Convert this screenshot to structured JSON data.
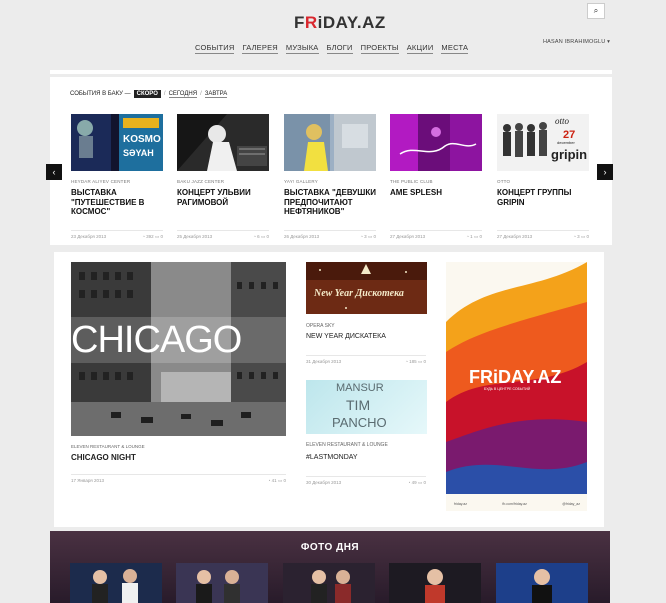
{
  "header": {
    "logo_pre": "F",
    "logo_r": "R",
    "logo_post": "iDAY.AZ",
    "search_icon": "⌕",
    "user_name": "HASAN IBRAHIMOGLU ▾",
    "nav": [
      "СОБЫТИЯ",
      "ГАЛЕРЕЯ",
      "МУЗЫКА",
      "БЛОГИ",
      "ПРОЕКТЫ",
      "АКЦИИ",
      "МЕСТА"
    ]
  },
  "events": {
    "heading": "СОБЫТИЯ В БАКУ —",
    "tab_soon": "СКОРО",
    "tab_today": "СЕГОДНЯ",
    "tab_tomorrow": "ЗАВТРА",
    "sep": "/",
    "prev_icon": "‹",
    "next_icon": "›",
    "items": [
      {
        "venue": "HEYDAR ALIYEV CENTER",
        "title": "ВЫСТАВКА \"ПУТЕШЕСТВИЕ В КОСМОС\"",
        "date": "23 Декабря 2013",
        "views": "392",
        "comments": "0"
      },
      {
        "venue": "BAKU JAZZ CENTER",
        "title": "КОНЦЕРТ УЛЬВИИ РАГИМОВОЙ",
        "date": "25 Декабря 2013",
        "views": "6",
        "comments": "0"
      },
      {
        "venue": "YAY! GALLERY",
        "title": "ВЫСТАВКА \"ДЕВУШКИ ПРЕДПОЧИТАЮТ НЕФТЯНИКОВ\"",
        "date": "26 Декабря 2013",
        "views": "3",
        "comments": "0"
      },
      {
        "venue": "THE PUBLIC CLUB",
        "title": "AME SPLESH",
        "date": "27 Декабря 2013",
        "views": "1",
        "comments": "0"
      },
      {
        "venue": "OTTO",
        "title": "КОНЦЕРТ ГРУППЫ GRIPIN",
        "date": "27 Декабря 2013",
        "views": "3",
        "comments": "0"
      }
    ]
  },
  "thumbs": {
    "kosmos_1": "KOSMO",
    "kosmos_2": "SƏYAH",
    "otto": "otto",
    "date_day": "27",
    "date_month": "december",
    "gripin": "gripin"
  },
  "featured": {
    "image_text": "CHICAGO",
    "venue": "ELEVEN RESTAURANT & LOUNGE",
    "title": "CHICAGO NIGHT",
    "date": "17 Января 2013",
    "views": "41",
    "comments": "0"
  },
  "newyear": {
    "image_text": "New Year Дискотека",
    "venue": "OPERA SKY",
    "title": "NEW YEAR ДИСКАТЕКА",
    "date": "31 Декабря 2013",
    "views": "185",
    "comments": "0"
  },
  "mansur": {
    "line1": "MANSUR",
    "line2": "TIM",
    "line3": "PANCHO",
    "venue": "ELEVEN RESTAURANT & LOUNGE",
    "title": "#LASTMONDAY",
    "date": "30 Декабря 2013",
    "views": "49",
    "comments": "0"
  },
  "ad": {
    "brand": "FRiDAY.AZ",
    "tagline": "БУДЬ В ЦЕНТРЕ СОБЫТИЙ",
    "site": "friday.az",
    "facebook": "fb.com/friday.az",
    "twitter": "@friday_az"
  },
  "photo_day": {
    "title": "ФОТО ДНЯ"
  },
  "colors": {
    "accent": "#d9272e",
    "dark": "#111111"
  }
}
